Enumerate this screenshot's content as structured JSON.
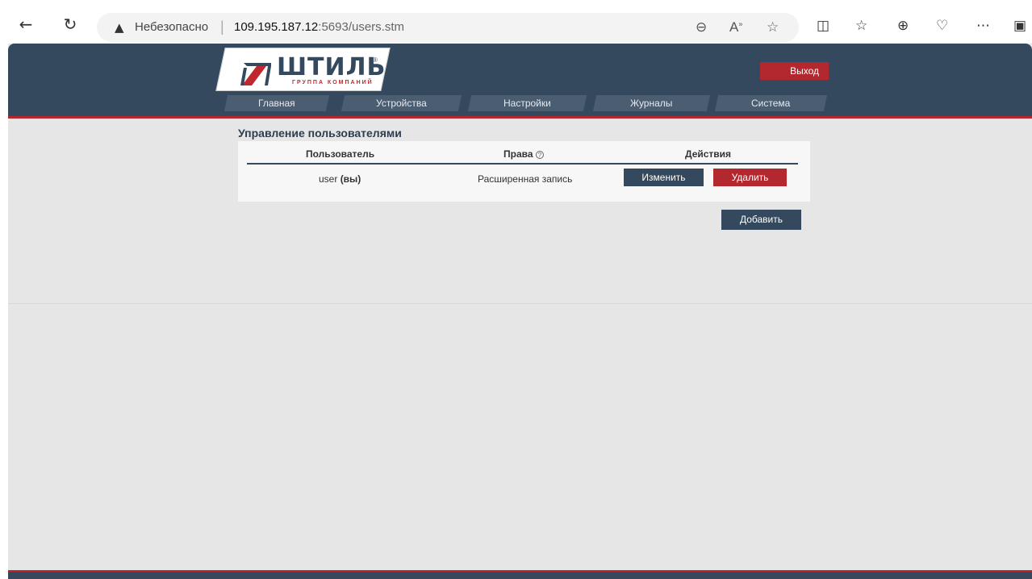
{
  "browser": {
    "back_icon": "←",
    "reload_icon": "↻",
    "warning_icon": "▲",
    "insecure_label": "Небезопасно",
    "separator": "|",
    "url_host": "109.195.187.12",
    "url_rest": ":5693/users.stm",
    "toolbar_icons": [
      "zoom-out-icon",
      "read-aloud-icon",
      "favorite-icon",
      "split-screen-icon",
      "favorites-list-icon",
      "collections-icon",
      "health-icon",
      "more-icon",
      "sidebar-icon"
    ]
  },
  "header": {
    "logo_text": "ШТИЛЬ",
    "logo_sub": "ГРУППА КОМПАНИЙ",
    "logo_reg": "®",
    "logout_label": "Выход",
    "menu": [
      {
        "label": "Главная"
      },
      {
        "label": "Устройства"
      },
      {
        "label": "Настройки"
      },
      {
        "label": "Журналы"
      },
      {
        "label": "Система"
      }
    ]
  },
  "users": {
    "title": "Управление пользователями",
    "columns": {
      "user": "Пользователь",
      "rights": "Права",
      "rights_help": "?",
      "actions": "Действия"
    },
    "rows": [
      {
        "user": "user",
        "you_marker": "(вы)",
        "rights": "Расширенная запись",
        "edit_label": "Изменить",
        "delete_label": "Удалить"
      }
    ],
    "add_label": "Добавить"
  },
  "colors": {
    "header_bg": "#34495e",
    "accent_red": "#b3282f",
    "page_bg": "#e6e6e6"
  }
}
